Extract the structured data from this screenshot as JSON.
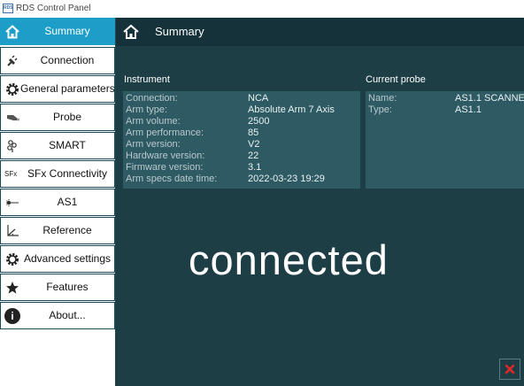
{
  "window": {
    "title": "RDS Control Panel",
    "icon_text": "RDS"
  },
  "sidebar": {
    "items": [
      {
        "label": "Summary",
        "icon": "home-icon",
        "active": true
      },
      {
        "label": "Connection",
        "icon": "plug-icon",
        "active": false
      },
      {
        "label": "General parameters",
        "icon": "gear-icon",
        "active": false
      },
      {
        "label": "Probe",
        "icon": "probe-icon",
        "active": false
      },
      {
        "label": "SMART",
        "icon": "smart-icon",
        "active": false
      },
      {
        "label": "SFx Connectivity",
        "icon": "sfx-icon",
        "icon_text": "SFx",
        "active": false
      },
      {
        "label": "AS1",
        "icon": "laser-icon",
        "active": false
      },
      {
        "label": "Reference",
        "icon": "axes-icon",
        "active": false
      },
      {
        "label": "Advanced settings",
        "icon": "gear-icon",
        "active": false
      },
      {
        "label": "Features",
        "icon": "star-icon",
        "active": false
      },
      {
        "label": "About...",
        "icon": "info-icon",
        "icon_text": "i",
        "active": false
      }
    ]
  },
  "header": {
    "title": "Summary"
  },
  "instrument": {
    "title": "Instrument",
    "rows": [
      {
        "label": "Connection:",
        "value": "NCA"
      },
      {
        "label": "Arm type:",
        "value": "Absolute Arm 7 Axis"
      },
      {
        "label": "Arm volume:",
        "value": "2500"
      },
      {
        "label": "Arm performance:",
        "value": "85"
      },
      {
        "label": "Arm version:",
        "value": "V2"
      },
      {
        "label": "Hardware version:",
        "value": "22"
      },
      {
        "label": "Firmware version:",
        "value": "3.1"
      },
      {
        "label": "Arm specs date time:",
        "value": "2022-03-23 19:29"
      }
    ]
  },
  "probe": {
    "title": "Current probe",
    "rows": [
      {
        "label": "Name:",
        "value": "AS1.1 SCANNE"
      },
      {
        "label": "Type:",
        "value": "AS1.1"
      }
    ]
  },
  "status": {
    "text": "connected"
  },
  "colors": {
    "accent": "#1c9ec8",
    "background": "#1e3e46",
    "panel": "#2e5a63",
    "header": "#15313a",
    "close": "#e02828"
  }
}
